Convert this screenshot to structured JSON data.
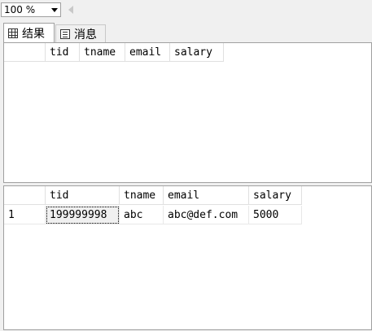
{
  "toolbar": {
    "zoom_value": "100 %"
  },
  "tabs": [
    {
      "label": "结果",
      "icon": "grid-icon"
    },
    {
      "label": "消息",
      "icon": "message-icon"
    }
  ],
  "result_top": {
    "columns": [
      "tid",
      "tname",
      "email",
      "salary"
    ]
  },
  "result_bottom": {
    "columns": [
      "tid",
      "tname",
      "email",
      "salary"
    ],
    "rows": [
      {
        "row_number": "1",
        "cells": [
          "199999998",
          "abc",
          "abc@def.com",
          "5000"
        ]
      }
    ]
  }
}
